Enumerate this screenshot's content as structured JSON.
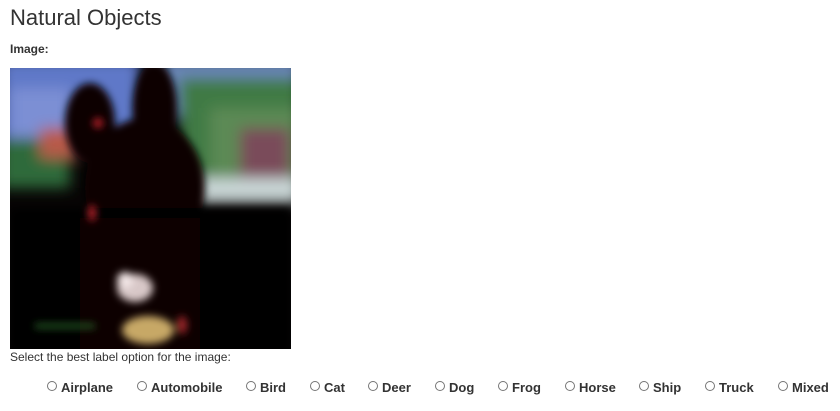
{
  "page": {
    "title": "Natural Objects",
    "image_label": "Image:",
    "prompt": "Select the best label option for the image:"
  },
  "options": [
    {
      "label": "Airplane",
      "selected": false
    },
    {
      "label": "Automobile",
      "selected": false
    },
    {
      "label": "Bird",
      "selected": false
    },
    {
      "label": "Cat",
      "selected": false
    },
    {
      "label": "Deer",
      "selected": false
    },
    {
      "label": "Dog",
      "selected": false
    },
    {
      "label": "Frog",
      "selected": false
    },
    {
      "label": "Horse",
      "selected": false
    },
    {
      "label": "Ship",
      "selected": false
    },
    {
      "label": "Truck",
      "selected": false
    },
    {
      "label": "Mixed",
      "selected": false
    }
  ]
}
